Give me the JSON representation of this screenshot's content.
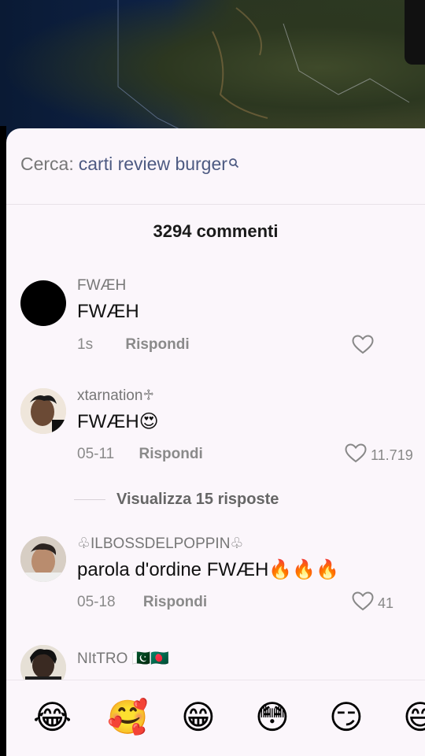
{
  "search": {
    "label": "Cerca:",
    "query": "carti review burger"
  },
  "comments_count": "3294 commenti",
  "comments": [
    {
      "username": "FWÆH",
      "text": "FWÆH",
      "time": "1s",
      "reply": "Rispondi",
      "likes": ""
    },
    {
      "username": "xtarnation♱",
      "text": "FWÆH😍",
      "time": "05-11",
      "reply": "Rispondi",
      "likes": "11.719",
      "view_replies": "Visualizza 15 risposte"
    },
    {
      "username": "♧ILBOSSDELPOPPIN♧",
      "text": "parola d'ordine FWÆH🔥🔥🔥",
      "time": "05-18",
      "reply": "Rispondi",
      "likes": "41"
    },
    {
      "username": "NItTRO 🇵🇰🇧🇩",
      "text": "",
      "time": "",
      "reply": "",
      "likes": ""
    }
  ],
  "emoji_bar": [
    "😂",
    "🥰",
    "😁",
    "😳",
    "😏",
    "😄"
  ]
}
